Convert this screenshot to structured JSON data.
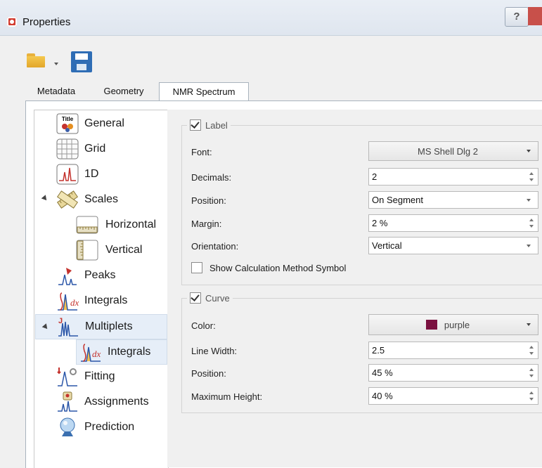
{
  "window": {
    "title": "Properties",
    "help_label": "?"
  },
  "toolbar": {
    "open_icon": "folder-open-icon",
    "save_icon": "save-icon"
  },
  "tabs": [
    {
      "label": "Metadata"
    },
    {
      "label": "Geometry"
    },
    {
      "label": "NMR Spectrum",
      "active": true
    }
  ],
  "tree": {
    "items": [
      {
        "label": "General",
        "icon": "title-icon"
      },
      {
        "label": "Grid",
        "icon": "grid-icon"
      },
      {
        "label": "1D",
        "icon": "spectrum-1d-icon"
      },
      {
        "label": "Scales",
        "icon": "ruler-icon",
        "expanded": true
      },
      {
        "label": "Horizontal",
        "icon": "horizontal-ruler-icon"
      },
      {
        "label": "Vertical",
        "icon": "vertical-ruler-icon"
      },
      {
        "label": "Peaks",
        "icon": "peaks-icon"
      },
      {
        "label": "Integrals",
        "icon": "integrals-icon"
      },
      {
        "label": "Multiplets",
        "icon": "multiplets-icon",
        "expanded": true
      },
      {
        "label": "Integrals",
        "icon": "multiplet-integrals-icon",
        "selected": true
      },
      {
        "label": "Fitting",
        "icon": "fitting-icon"
      },
      {
        "label": "Assignments",
        "icon": "assignments-icon"
      },
      {
        "label": "Prediction",
        "icon": "prediction-icon"
      }
    ]
  },
  "label_group": {
    "title": "Label",
    "checked": true,
    "font_label": "Font:",
    "font_value": "MS Shell Dlg 2",
    "decimals_label": "Decimals:",
    "decimals_value": "2",
    "position_label": "Position:",
    "position_value": "On Segment",
    "margin_label": "Margin:",
    "margin_value": "2 %",
    "orientation_label": "Orientation:",
    "orientation_value": "Vertical",
    "show_symbol_label": "Show Calculation Method Symbol",
    "show_symbol_checked": false
  },
  "curve_group": {
    "title": "Curve",
    "checked": true,
    "color_label": "Color:",
    "color_value": "purple",
    "color_hex": "#7b1140",
    "line_width_label": "Line Width:",
    "line_width_value": "2.5",
    "position_label": "Position:",
    "position_value": "45 %",
    "max_height_label": "Maximum Height:",
    "max_height_value": "40 %"
  }
}
